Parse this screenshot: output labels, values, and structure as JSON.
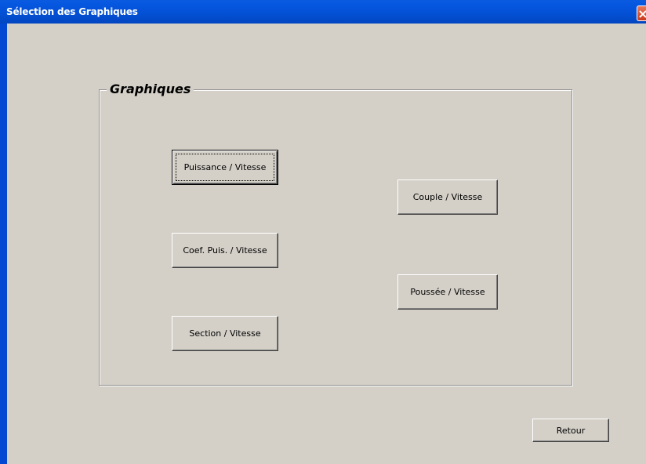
{
  "window": {
    "title": "Sélection des Graphiques"
  },
  "group": {
    "legend": "Graphiques"
  },
  "buttons": {
    "puissance": "Puissance / Vitesse",
    "couple": "Couple / Vitesse",
    "coef_puis": "Coef. Puis. / Vitesse",
    "poussee": "Poussée / Vitesse",
    "section": "Section / Vitesse",
    "retour": "Retour"
  },
  "icons": {
    "close": "close-icon"
  },
  "colors": {
    "titlebar": "#0350d4",
    "client": "#d4d0c8",
    "close_button": "#c9391a"
  }
}
